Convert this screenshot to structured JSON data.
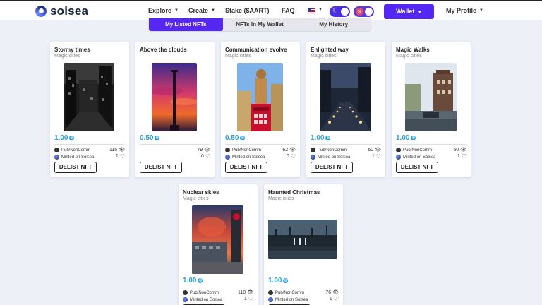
{
  "header": {
    "logo_text": "solsea",
    "nav": [
      {
        "label": "Explore",
        "dropdown": true
      },
      {
        "label": "Create",
        "dropdown": true
      },
      {
        "label": "Stake ($AART)",
        "dropdown": false
      },
      {
        "label": "FAQ",
        "dropdown": false
      }
    ],
    "language": "en-US",
    "wallet_label": "Wallet",
    "profile_label": "My Profile"
  },
  "tabs": [
    {
      "label": "My Listed NFTs",
      "active": true
    },
    {
      "label": "NFTs In My Wallet",
      "active": false
    },
    {
      "label": "My History",
      "active": false
    }
  ],
  "card_common": {
    "delist_label": "DELIST NFT",
    "license_label": "Pub/NonComm",
    "minted_label": "Minted on Solsea"
  },
  "nfts": [
    {
      "title": "Stormy times",
      "collection": "Magic cities",
      "price": "1.00",
      "views": "115",
      "likes": "1",
      "show_license": true,
      "show_minted": true
    },
    {
      "title": "Above the clouds",
      "collection": "",
      "price": "0.50",
      "views": "79",
      "likes": "0",
      "show_license": false,
      "show_minted": false
    },
    {
      "title": "Communication evolve",
      "collection": "Magic cities",
      "price": "0.50",
      "views": "62",
      "likes": "0",
      "show_license": true,
      "show_minted": true
    },
    {
      "title": "Enlighted way",
      "collection": "Magic cities",
      "price": "1.00",
      "views": "60",
      "likes": "1",
      "show_license": true,
      "show_minted": true
    },
    {
      "title": "Magic Walks",
      "collection": "Magic cities",
      "price": "1.00",
      "views": "50",
      "likes": "1",
      "show_license": true,
      "show_minted": true
    },
    {
      "title": "Nuclear skies",
      "collection": "Magic cities",
      "price": "1.00",
      "views": "118",
      "likes": "1",
      "show_license": true,
      "show_minted": true
    },
    {
      "title": "Haunted Christmas",
      "collection": "Magic cities",
      "price": "1.00",
      "views": "76",
      "likes": "1",
      "show_license": true,
      "show_minted": true
    }
  ],
  "colors": {
    "accent": "#5527f2",
    "price": "#2a9fd6"
  }
}
